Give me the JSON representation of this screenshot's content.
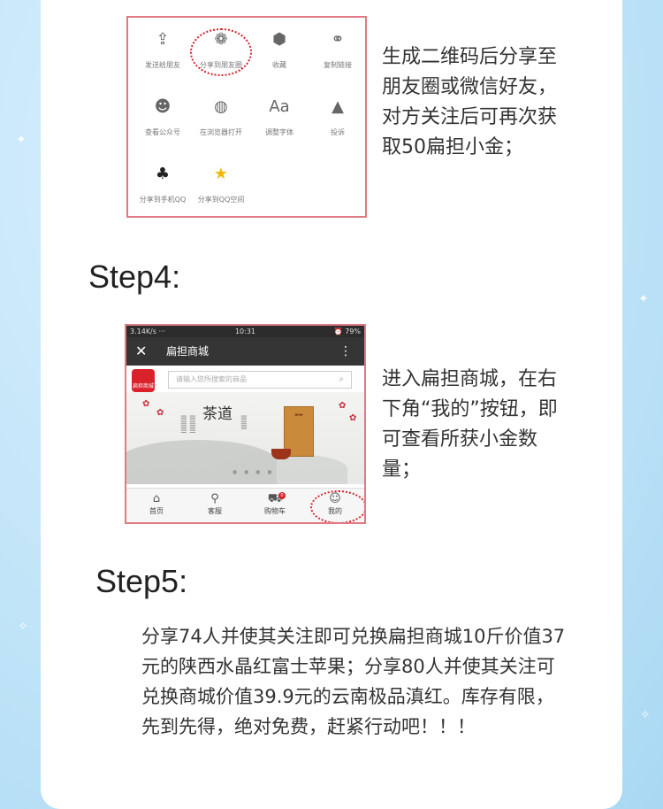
{
  "share_panel": {
    "items": [
      {
        "label": "发送给朋友",
        "icon": "share-forward-icon",
        "glyph": "⇪"
      },
      {
        "label": "分享到朋友圈",
        "icon": "moments-icon",
        "glyph": "❁"
      },
      {
        "label": "收藏",
        "icon": "favorite-cube-icon",
        "glyph": "⬢"
      },
      {
        "label": "复制链接",
        "icon": "link-icon",
        "glyph": "⚭"
      },
      {
        "label": "查看公众号",
        "icon": "official-account-icon",
        "glyph": "☻"
      },
      {
        "label": "在浏览器打开",
        "icon": "browser-globe-icon",
        "glyph": "◍"
      },
      {
        "label": "调整字体",
        "icon": "font-size-icon",
        "glyph": "Aa"
      },
      {
        "label": "投诉",
        "icon": "warning-icon",
        "glyph": "▲"
      },
      {
        "label": "分享到手机QQ",
        "icon": "qq-penguin-icon",
        "glyph": "♣"
      },
      {
        "label": "分享到QQ空间",
        "icon": "qzone-star-icon",
        "glyph": "★"
      }
    ]
  },
  "step3_text": "生成二维码后分享至朋友圈或微信好友，对方关注后可再次获取50扁担小金；",
  "step4": {
    "heading": "Step4:",
    "text": "进入扁担商城，在右下角“我的”按钮，即可查看所获小金数量；"
  },
  "phone": {
    "status_left": "3.14K/s ··· ",
    "status_time": "10:31",
    "status_right": "⏰ 79%",
    "title": "扁担商城",
    "logo_text": "扁担商城",
    "search_placeholder": "请输入您所搜索的商品",
    "banner_title": "茶道",
    "nav": [
      {
        "label": "首页",
        "icon": "home-icon",
        "glyph": "⌂"
      },
      {
        "label": "客服",
        "icon": "location-pin-icon",
        "glyph": "⚲"
      },
      {
        "label": "购物车",
        "icon": "cart-icon",
        "glyph": "⛟",
        "badge": "0"
      },
      {
        "label": "我的",
        "icon": "user-icon",
        "glyph": "☺"
      }
    ]
  },
  "step5": {
    "heading": "Step5:",
    "text": "分享74人并使其关注即可兑换扁担商城10斤价值37元的陕西水晶红富士苹果；分享80人并使其关注可兑换商城价值39.9元的云南极品滇红。库存有限，先到先得，绝对免费，赶紧行动吧！！！"
  },
  "colors": {
    "highlight_circle": "#d6232b",
    "frame_border": "#e07a84",
    "background_blue": "#bfe3f7"
  }
}
